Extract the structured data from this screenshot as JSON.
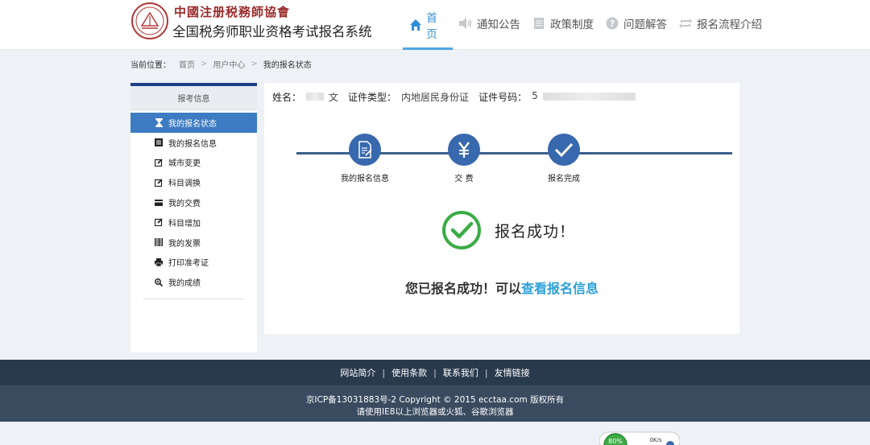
{
  "header": {
    "org_name": "中國注册税務師協會",
    "system_title": "全国税务师职业资格考试报名系统",
    "nav": [
      {
        "label": "首页",
        "icon": "home-icon",
        "active": true
      },
      {
        "label": "通知公告",
        "icon": "speaker-icon",
        "active": false
      },
      {
        "label": "政策制度",
        "icon": "document-icon",
        "active": false
      },
      {
        "label": "问题解答",
        "icon": "question-icon",
        "active": false
      },
      {
        "label": "报名流程介绍",
        "icon": "repeat-icon",
        "active": false
      }
    ]
  },
  "breadcrumb": {
    "label": "当前位置：",
    "items": [
      "首页",
      "用户中心",
      "我的报名状态"
    ],
    "separator": ">"
  },
  "sidebar": {
    "title": "报考信息",
    "items": [
      {
        "label": "我的报名状态",
        "icon": "hourglass-icon",
        "active": true
      },
      {
        "label": "我的报名信息",
        "icon": "list-icon",
        "active": false
      },
      {
        "label": "城市变更",
        "icon": "edit-icon",
        "active": false
      },
      {
        "label": "科目调换",
        "icon": "edit-icon",
        "active": false
      },
      {
        "label": "我的交费",
        "icon": "card-icon",
        "active": false
      },
      {
        "label": "科目增加",
        "icon": "edit-icon",
        "active": false
      },
      {
        "label": "我的发票",
        "icon": "barcode-icon",
        "active": false
      },
      {
        "label": "打印准考证",
        "icon": "printer-icon",
        "active": false
      },
      {
        "label": "我的成绩",
        "icon": "zoom-icon",
        "active": false
      }
    ]
  },
  "main": {
    "name_label": "姓名：",
    "name_value": "文",
    "id_type_label": "证件类型：",
    "id_type_value": "内地居民身份证",
    "id_number_label": "证件号码：",
    "id_number_value": "5",
    "steps": [
      {
        "label": "我的报名信息",
        "icon": "form-icon"
      },
      {
        "label": "交 费",
        "icon": "yuan-icon"
      },
      {
        "label": "报名完成",
        "icon": "check-icon"
      }
    ],
    "success_title": "报名成功！",
    "result_text": "您已报名成功！可以",
    "result_link": "查看报名信息"
  },
  "footer": {
    "links": [
      "网站简介",
      "使用条款",
      "联系我们",
      "友情链接"
    ],
    "copyright": "京ICP备13031883号-2 Copyright © 2015 ecctaa.com 版权所有",
    "browser_note": "请使用IE8以上浏览器或火狐、谷歌浏览器"
  },
  "widget": {
    "percent": "80%",
    "speed": "0K/s"
  },
  "colors": {
    "accent": "#2e8ed6",
    "sidebar_active": "#3d7cc3",
    "step_circle": "#3868ad",
    "success_green": "#3aac45",
    "footer_dark": "#2a3a4d",
    "link": "#2aa0d8"
  }
}
